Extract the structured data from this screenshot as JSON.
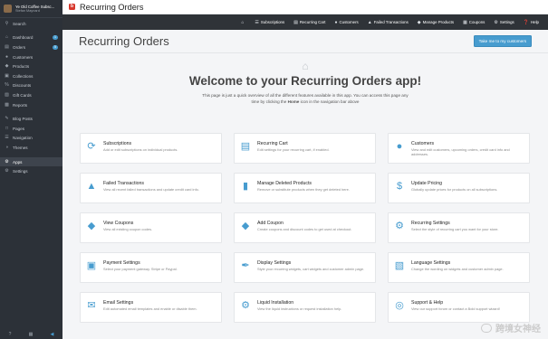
{
  "sidebar": {
    "store_name": "Ye Old Coffee Subsc...",
    "store_user": "Stefan Maynard",
    "search_label": "Search",
    "items": [
      {
        "label": "Dashboard",
        "icon": "house-icon",
        "badge": "1"
      },
      {
        "label": "Orders",
        "icon": "orders-icon",
        "badge": "5"
      },
      {
        "label": "Customers",
        "icon": "person-icon",
        "badge": ""
      },
      {
        "label": "Products",
        "icon": "tag-icon",
        "badge": ""
      },
      {
        "label": "Collections",
        "icon": "collections-icon",
        "badge": ""
      },
      {
        "label": "Discounts",
        "icon": "discount-icon",
        "badge": ""
      },
      {
        "label": "Gift Cards",
        "icon": "gift-card-icon",
        "badge": ""
      },
      {
        "label": "Reports",
        "icon": "chart-icon",
        "badge": ""
      }
    ],
    "items2": [
      {
        "label": "Blog Posts",
        "icon": "blog-icon"
      },
      {
        "label": "Pages",
        "icon": "page-icon"
      },
      {
        "label": "Navigation",
        "icon": "navigation-icon"
      },
      {
        "label": "Themes",
        "icon": "theme-icon"
      }
    ],
    "items3": [
      {
        "label": "Apps",
        "icon": "apps-icon"
      },
      {
        "label": "Settings",
        "icon": "gear-icon"
      }
    ]
  },
  "header": {
    "app_name": "Recurring Orders"
  },
  "nav": {
    "items": [
      {
        "label": "Subscriptions"
      },
      {
        "label": "Recurring Cart"
      },
      {
        "label": "Customers"
      },
      {
        "label": "Failed Transactions"
      },
      {
        "label": "Manage Products"
      },
      {
        "label": "Coupons"
      },
      {
        "label": "Settings"
      },
      {
        "label": "Help"
      }
    ]
  },
  "main": {
    "page_title": "Recurring Orders",
    "customers_button": "Take me to my customers",
    "welcome_title": "Welcome to your Recurring Orders app!",
    "welcome_text_1": "This page is just a quick overview of all the different features available in this app. You can access this page any time by clicking the ",
    "welcome_home": "Home",
    "welcome_text_2": " icon in the navigation bar above",
    "cards": [
      {
        "title": "Subscriptions",
        "desc": "Add or edit subscriptions on individual products."
      },
      {
        "title": "Recurring Cart",
        "desc": "Edit settings for your recurring cart, if enabled."
      },
      {
        "title": "Customers",
        "desc": "View and edit customers, upcoming orders, credit card info and addresses."
      },
      {
        "title": "Failed Transactions",
        "desc": "View all recent failed transactions and update credit card info."
      },
      {
        "title": "Manage Deleted Products",
        "desc": "Remove or substitute products when they get deleted here."
      },
      {
        "title": "Update Pricing",
        "desc": "Globally update prices for products on all subscriptions."
      },
      {
        "title": "View Coupons",
        "desc": "View all existing coupon codes."
      },
      {
        "title": "Add Coupon",
        "desc": "Create coupons and discount codes to get used at checkout."
      },
      {
        "title": "Recurring Settings",
        "desc": "Select the style of recurring cart you want for your store."
      },
      {
        "title": "Payment Settings",
        "desc": "Select your payment gateway. Stripe or Paypal."
      },
      {
        "title": "Display Settings",
        "desc": "Style your recurring widgets, cart widgets and customer admin page."
      },
      {
        "title": "Language Settings",
        "desc": "Change the wording on widgets and customer admin page."
      },
      {
        "title": "Email Settings",
        "desc": "Edit automated email templates and enable or disable them."
      },
      {
        "title": "Liquid Installation",
        "desc": "View the liquid instructions or request installation help."
      },
      {
        "title": "Support & Help",
        "desc": "View our support forum or contact a Bold support wizard!"
      }
    ]
  },
  "watermark": "跨境女神经",
  "colors": {
    "accent": "#479ccf",
    "sidebar": "#2c3138",
    "navbar": "#2f3338",
    "logo": "#d7372c"
  }
}
